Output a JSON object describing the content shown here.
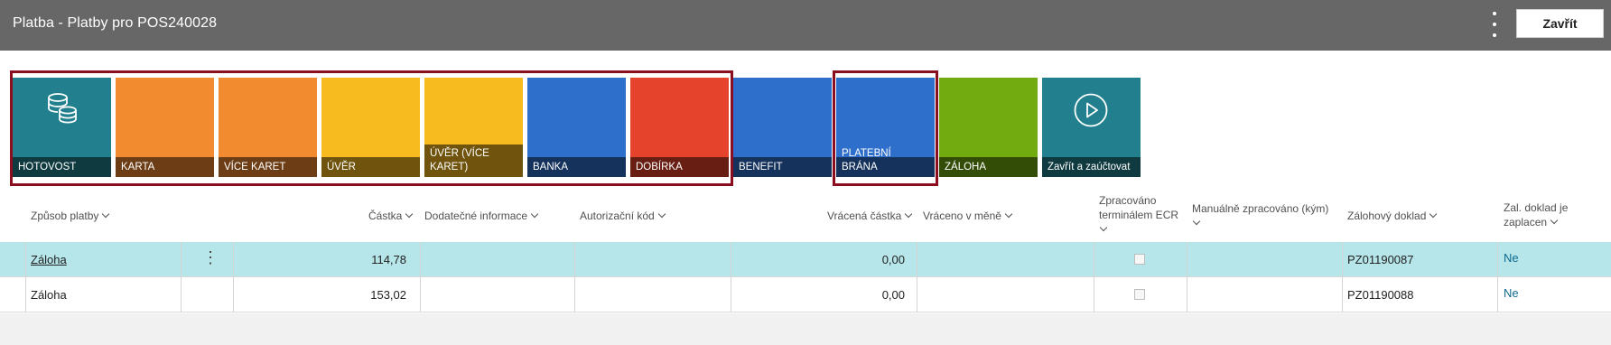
{
  "header": {
    "title": "Platba - Platby pro POS240028",
    "more_icon": "vertical-dots-icon",
    "close_label": "Zavřít"
  },
  "tiles": [
    {
      "label": "HOTOVOST",
      "color": "#22808e",
      "icon": "coins-icon"
    },
    {
      "label": "KARTA",
      "color": "#f28a2f",
      "icon": ""
    },
    {
      "label": "VÍCE KARET",
      "color": "#f28a2f",
      "icon": ""
    },
    {
      "label": "ÚVĚR",
      "color": "#f8bb1f",
      "icon": ""
    },
    {
      "label": "ÚVĚR (VÍCE KARET)",
      "color": "#f8bb1f",
      "icon": ""
    },
    {
      "label": "BANKA",
      "color": "#2f6fcc",
      "icon": ""
    },
    {
      "label": "DOBÍRKA",
      "color": "#e6432c",
      "icon": ""
    },
    {
      "label": "BENEFIT",
      "color": "#2f6fcc",
      "icon": ""
    },
    {
      "label": "PLATEBNÍ BRÁNA",
      "color": "#2f6fcc",
      "icon": ""
    },
    {
      "label": "ZÁLOHA",
      "color": "#71ab10",
      "icon": ""
    },
    {
      "label": "Zavřít a zaúčtovat",
      "color": "#22808e",
      "icon": "play-circle-icon"
    }
  ],
  "table": {
    "columns": {
      "method": "Způsob platby",
      "amount": "Částka",
      "info": "Dodatečné informace",
      "auth": "Autorizační kód",
      "returned": "Vrácená částka",
      "currency": "Vráceno v měně",
      "ecr_line1": "Zpracováno",
      "ecr_line2": "terminálem ECR",
      "manual": "Manuálně zpracováno (kým)",
      "deposit": "Zálohový doklad",
      "paid_line1": "Zal. doklad je",
      "paid_line2": "zaplacen"
    },
    "rows": [
      {
        "method": "Záloha",
        "amount": "114,78",
        "returned": "0,00",
        "deposit": "PZ01190087",
        "paid": "Ne",
        "menu": "⋮"
      },
      {
        "method": "Záloha",
        "amount": "153,02",
        "returned": "0,00",
        "deposit": "PZ01190088",
        "paid": "Ne",
        "menu": ""
      }
    ]
  },
  "colors": {
    "header_bg": "#676767",
    "highlight_border": "#8b0e1e",
    "selected_row": "#b6e6ea"
  }
}
